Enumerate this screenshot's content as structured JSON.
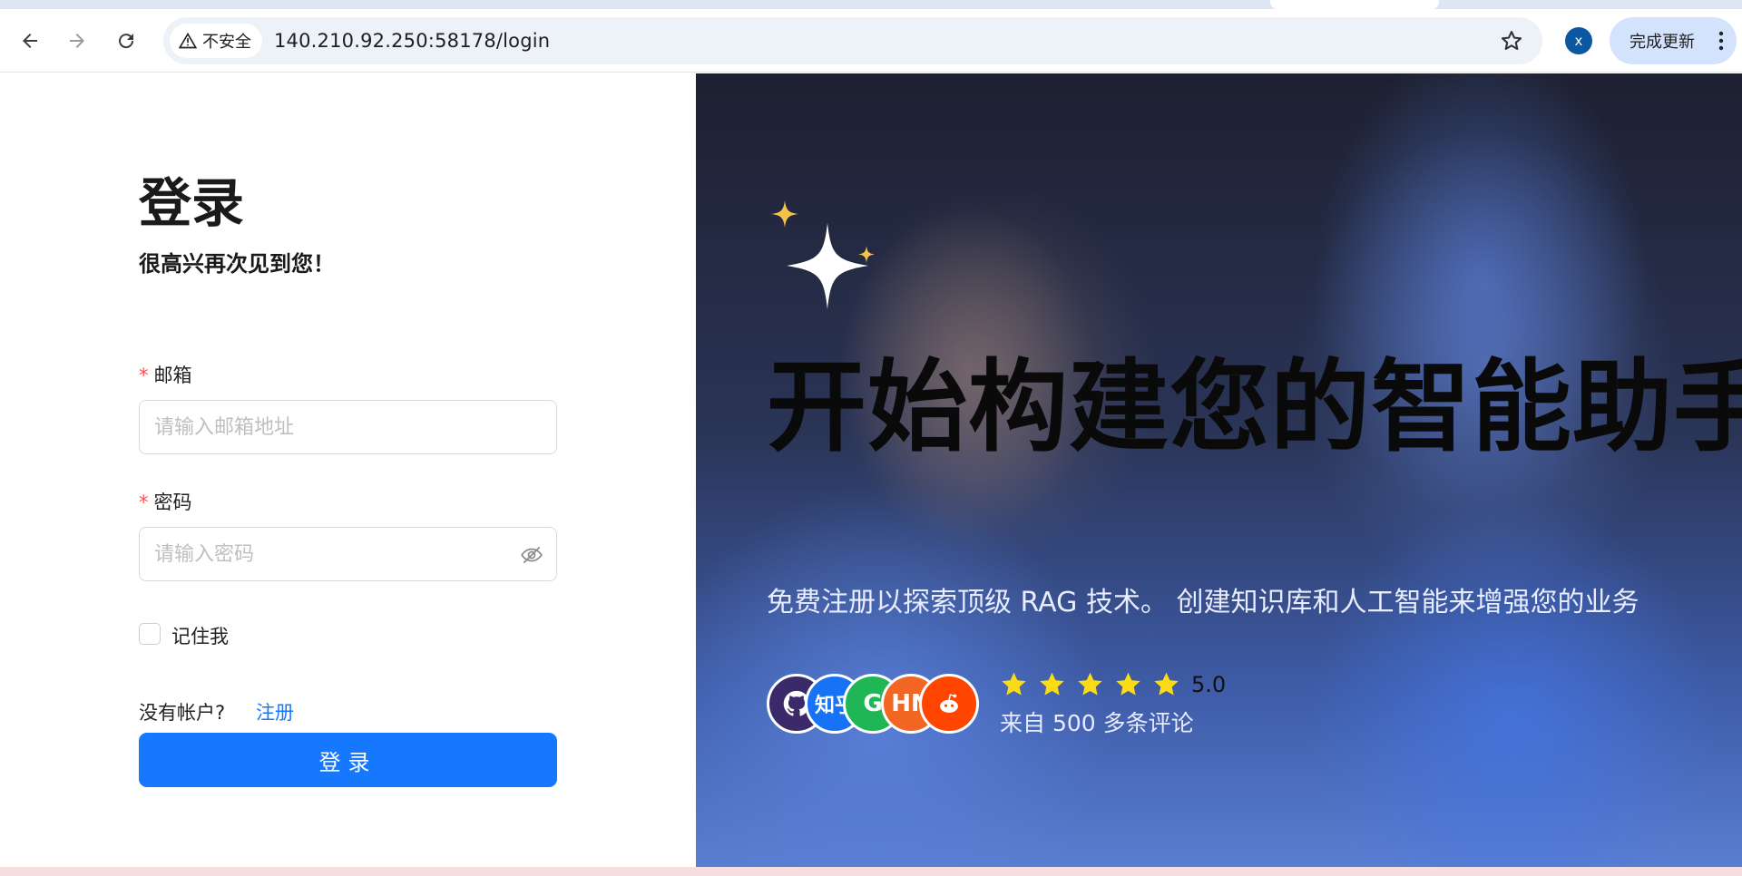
{
  "browser": {
    "security_label": "不安全",
    "url": "140.210.92.250:58178/login",
    "avatar_letter": "x",
    "update_button": "完成更新"
  },
  "login": {
    "title": "登录",
    "subtitle": "很高兴再次见到您！",
    "email_label": "邮箱",
    "email_placeholder": "请输入邮箱地址",
    "password_label": "密码",
    "password_placeholder": "请输入密码",
    "remember_me": "记住我",
    "no_account": "没有帐户?",
    "register_link": "注册",
    "login_button": "登录"
  },
  "hero": {
    "headline": "开始构建您的智能助手",
    "tagline": "免费注册以探索顶级 RAG 技术。 创建知识库和人工智能来增强您的业务",
    "rating": "5.0",
    "stars": 5,
    "reviews": "来自 500 多条评论",
    "logos": [
      {
        "name": "github",
        "text": "",
        "color": "#3a2a6a"
      },
      {
        "name": "zhihu",
        "text": "知乎",
        "color": "#1772f6"
      },
      {
        "name": "wechat",
        "text": "G",
        "color": "#1fb655"
      },
      {
        "name": "hackernews",
        "text": "HN",
        "color": "#f26522"
      },
      {
        "name": "reddit",
        "text": "",
        "color": "#ff4500"
      }
    ]
  },
  "colors": {
    "primary": "#1677ff",
    "required": "#ff4d4f",
    "star": "#fadb14"
  }
}
